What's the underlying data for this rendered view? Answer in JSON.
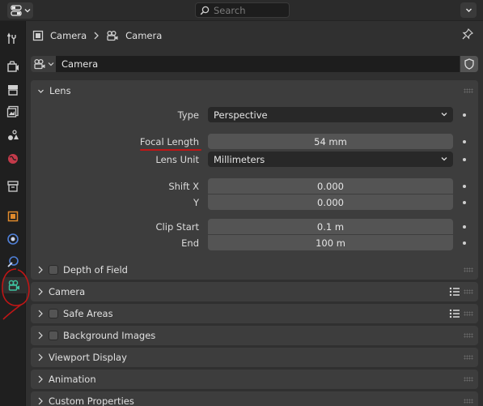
{
  "topbar": {
    "search_placeholder": "Search"
  },
  "breadcrumb": {
    "object_name": "Camera",
    "data_name": "Camera"
  },
  "datablock": {
    "name": "Camera"
  },
  "lens": {
    "title": "Lens",
    "type_label": "Type",
    "type_value": "Perspective",
    "focal_length_label": "Focal Length",
    "focal_length_value": "54 mm",
    "lens_unit_label": "Lens Unit",
    "lens_unit_value": "Millimeters",
    "shift_x_label": "Shift X",
    "shift_x_value": "0.000",
    "shift_y_label": "Y",
    "shift_y_value": "0.000",
    "clip_start_label": "Clip Start",
    "clip_start_value": "0.1 m",
    "clip_end_label": "End",
    "clip_end_value": "100 m"
  },
  "panels": {
    "depth_of_field": "Depth of Field",
    "camera": "Camera",
    "safe_areas": "Safe Areas",
    "background_images": "Background Images",
    "viewport_display": "Viewport Display",
    "animation": "Animation",
    "custom_properties": "Custom Properties"
  },
  "colors": {
    "accent_camera": "#3ec1a0",
    "annotation_red": "#c01616",
    "object_orange": "#e08a2c",
    "physics_blue": "#4f7fd6"
  }
}
